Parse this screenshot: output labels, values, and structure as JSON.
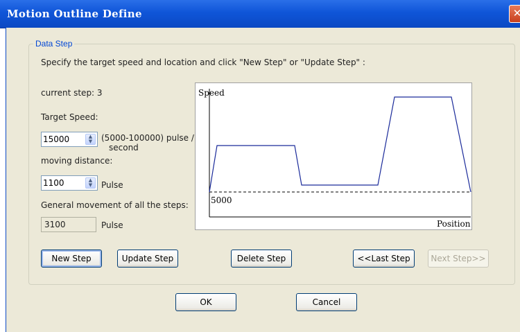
{
  "window": {
    "title": "Motion Outline Define",
    "close_glyph": "✕"
  },
  "group": {
    "legend": "Data Step",
    "instruction": "Specify the target speed and location and click \"New Step\" or \"Update Step\" :",
    "current_step": "current step: 3",
    "target_speed_label": "Target Speed:",
    "target_speed_value": "15000",
    "speed_range": "(5000-100000) pulse /",
    "speed_range_unit": "second",
    "distance_label": "moving distance:",
    "distance_value": "1100",
    "distance_unit": "Pulse",
    "general_label": "General movement of all the steps:",
    "general_value": "3100",
    "general_unit": "Pulse"
  },
  "buttons": {
    "new_step": "New Step",
    "update_step": "Update Step",
    "delete_step": "Delete Step",
    "last_step": "<<Last Step",
    "next_step": "Next Step>>",
    "ok": "OK",
    "cancel": "Cancel"
  },
  "icons": {
    "spin_up": "spin-up-arrow-icon",
    "spin_down": "spin-down-arrow-icon",
    "close": "close-icon"
  },
  "chart_data": {
    "type": "line",
    "ylabel": "Speed",
    "xlabel": "Position",
    "baseline_label": "5000",
    "line_color": "#1a2a9a",
    "baseline_style": "dashed",
    "axis_ticks": false
  }
}
